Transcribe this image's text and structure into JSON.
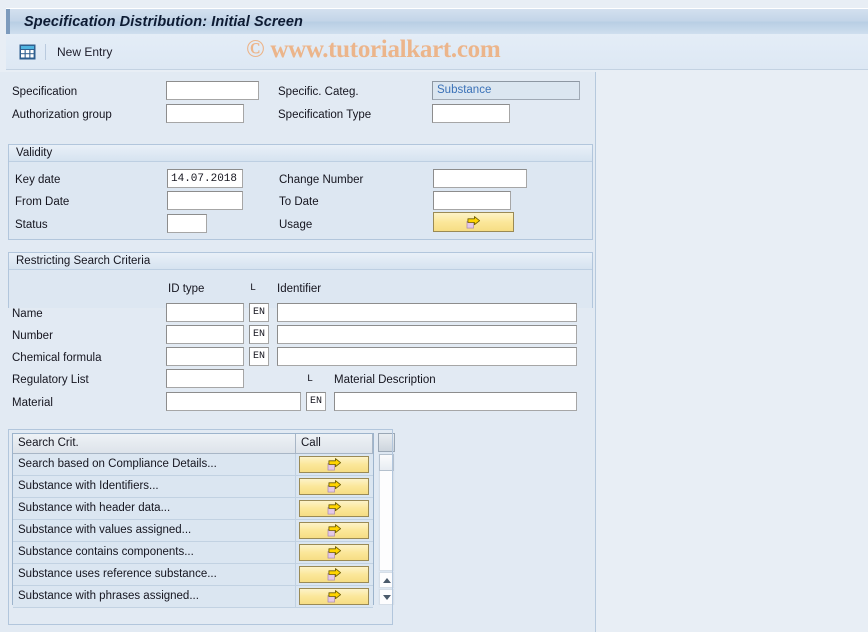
{
  "window": {
    "title": "Specification Distribution: Initial Screen"
  },
  "toolbar": {
    "grid_icon": "table-grid-icon",
    "new_entry_label": "New Entry"
  },
  "watermark": {
    "text": "© www.tutorialkart.com"
  },
  "header_form": {
    "specification_label": "Specification",
    "specification_value": "",
    "authorization_group_label": "Authorization group",
    "authorization_group_value": "",
    "specific_categ_label": "Specific. Categ.",
    "specific_categ_value": "Substance",
    "specification_type_label": "Specification Type",
    "specification_type_value": ""
  },
  "validity": {
    "title": "Validity",
    "key_date_label": "Key date",
    "key_date_value": "14.07.2018",
    "from_date_label": "From Date",
    "from_date_value": "",
    "status_label": "Status",
    "status_value": "",
    "change_number_label": "Change Number",
    "change_number_value": "",
    "to_date_label": "To Date",
    "to_date_value": "",
    "usage_label": "Usage",
    "usage_button_icon": "yellow-arrow-icon"
  },
  "search_criteria": {
    "title": "Restricting Search Criteria",
    "col_id_type": "ID type",
    "col_lang": "L",
    "col_identifier": "Identifier",
    "col_lang2": "L",
    "col_material_description": "Material Description",
    "rows": [
      {
        "label": "Name",
        "id_type": "",
        "lang": "EN",
        "identifier": ""
      },
      {
        "label": "Number",
        "id_type": "",
        "lang": "EN",
        "identifier": ""
      },
      {
        "label": "Chemical formula",
        "id_type": "",
        "lang": "EN",
        "identifier": ""
      }
    ],
    "regulatory_list_label": "Regulatory List",
    "regulatory_list_value": "",
    "material_label": "Material",
    "material_value": "",
    "material_lang": "EN",
    "material_description_value": ""
  },
  "search_table": {
    "col_search_crit": "Search Crit.",
    "col_call": "Call",
    "call_icon": "yellow-arrow-icon",
    "rows": [
      {
        "name": "Search based on Compliance Details..."
      },
      {
        "name": "Substance with Identifiers..."
      },
      {
        "name": "Substance with header data..."
      },
      {
        "name": "Substance with values assigned..."
      },
      {
        "name": "Substance contains components..."
      },
      {
        "name": "Substance uses reference substance..."
      },
      {
        "name": "Substance with phrases assigned..."
      }
    ]
  },
  "colors": {
    "title_bar": "#c3d5e8",
    "panel_bg": "#e2eaf3",
    "call_button": "#fbe79a",
    "display_field_text": "#3b72b8",
    "watermark": "#edb183"
  }
}
